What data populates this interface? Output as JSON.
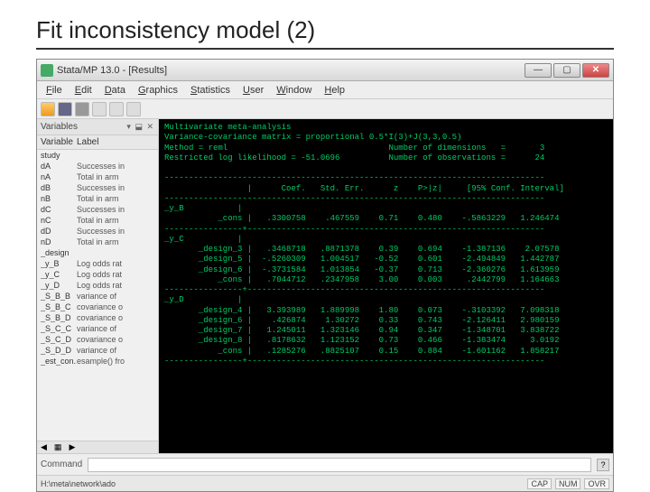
{
  "slide": {
    "title": "Fit inconsistency model (2)"
  },
  "window": {
    "title": "Stata/MP 13.0 - [Results]"
  },
  "menus": [
    "File",
    "Edit",
    "Data",
    "Graphics",
    "Statistics",
    "User",
    "Window",
    "Help"
  ],
  "sidebar": {
    "title": "Variables",
    "col1": "Variable",
    "col2": "Label",
    "items": [
      {
        "v": "study",
        "l": ""
      },
      {
        "v": "dA",
        "l": "Successes in"
      },
      {
        "v": "nA",
        "l": "Total in arm"
      },
      {
        "v": "dB",
        "l": "Successes in"
      },
      {
        "v": "nB",
        "l": "Total in arm"
      },
      {
        "v": "dC",
        "l": "Successes in"
      },
      {
        "v": "nC",
        "l": "Total in arm"
      },
      {
        "v": "dD",
        "l": "Successes in"
      },
      {
        "v": "nD",
        "l": "Total in arm"
      },
      {
        "v": "_design",
        "l": ""
      },
      {
        "v": "_y_B",
        "l": "Log odds rat"
      },
      {
        "v": "_y_C",
        "l": "Log odds rat"
      },
      {
        "v": "_y_D",
        "l": "Log odds rat"
      },
      {
        "v": "_S_B_B",
        "l": "variance of"
      },
      {
        "v": "_S_B_C",
        "l": "covariance o"
      },
      {
        "v": "_S_B_D",
        "l": "covariance o"
      },
      {
        "v": "_S_C_C",
        "l": "variance of"
      },
      {
        "v": "_S_C_D",
        "l": "covariance o"
      },
      {
        "v": "_S_D_D",
        "l": "variance of"
      },
      {
        "v": "_est_con..",
        "l": "esample() fro"
      }
    ]
  },
  "results": {
    "header": [
      "Multivariate meta-analysis",
      "Variance-covariance matrix = proportional 0.5*I(3)+J(3,3,0.5)",
      "Method = reml                                 Number of dimensions   =       3",
      "Restricted log likelihood = -51.0696          Number of observations =      24"
    ],
    "cols": "                 |      Coef.   Std. Err.      z    P>|z|     [95% Conf. Interval]",
    "groups": [
      {
        "name": "_y_B",
        "rows": [
          {
            "t": "_cons",
            "c": ".3300758",
            "se": ".467559",
            "z": "0.71",
            "p": "0.480",
            "lo": "-.5863229",
            "hi": "1.246474"
          }
        ]
      },
      {
        "name": "_y_C",
        "rows": [
          {
            "t": "_design_3",
            "c": ".3468718",
            "se": ".8871378",
            "z": "0.39",
            "p": "0.694",
            "lo": "-1.387136",
            "hi": "2.07578"
          },
          {
            "t": "_design_5",
            "c": "-.5260309",
            "se": "1.004517",
            "z": "-0.52",
            "p": "0.601",
            "lo": "-2.494849",
            "hi": "1.442787"
          },
          {
            "t": "_design_6",
            "c": "-.3731584",
            "se": "1.013854",
            "z": "-0.37",
            "p": "0.713",
            "lo": "-2.360276",
            "hi": "1.613959"
          },
          {
            "t": "_cons",
            "c": ".7044712",
            "se": ".2347958",
            "z": "3.00",
            "p": "0.003",
            "lo": ".2442799",
            "hi": "1.164663"
          }
        ]
      },
      {
        "name": "_y_D",
        "rows": [
          {
            "t": "_design_4",
            "c": "3.393989",
            "se": "1.889998",
            "z": "1.80",
            "p": "0.073",
            "lo": "-.3103392",
            "hi": "7.098318"
          },
          {
            "t": "_design_6",
            "c": ".426874",
            "se": "1.30272",
            "z": "0.33",
            "p": "0.743",
            "lo": "-2.126411",
            "hi": "2.980159"
          },
          {
            "t": "_design_7",
            "c": "1.245011",
            "se": "1.323146",
            "z": "0.94",
            "p": "0.347",
            "lo": "-1.348701",
            "hi": "3.838722"
          },
          {
            "t": "_design_8",
            "c": ".8178632",
            "se": "1.123152",
            "z": "0.73",
            "p": "0.466",
            "lo": "-1.383474",
            "hi": "3.0192"
          },
          {
            "t": "_cons",
            "c": ".1285276",
            "se": ".8825107",
            "z": "0.15",
            "p": "0.884",
            "lo": "-1.601162",
            "hi": "1.858217"
          }
        ]
      }
    ]
  },
  "command": {
    "label": "Command"
  },
  "status": {
    "path": "H:\\meta\\network\\ado",
    "indicators": [
      "CAP",
      "NUM",
      "OVR"
    ]
  }
}
